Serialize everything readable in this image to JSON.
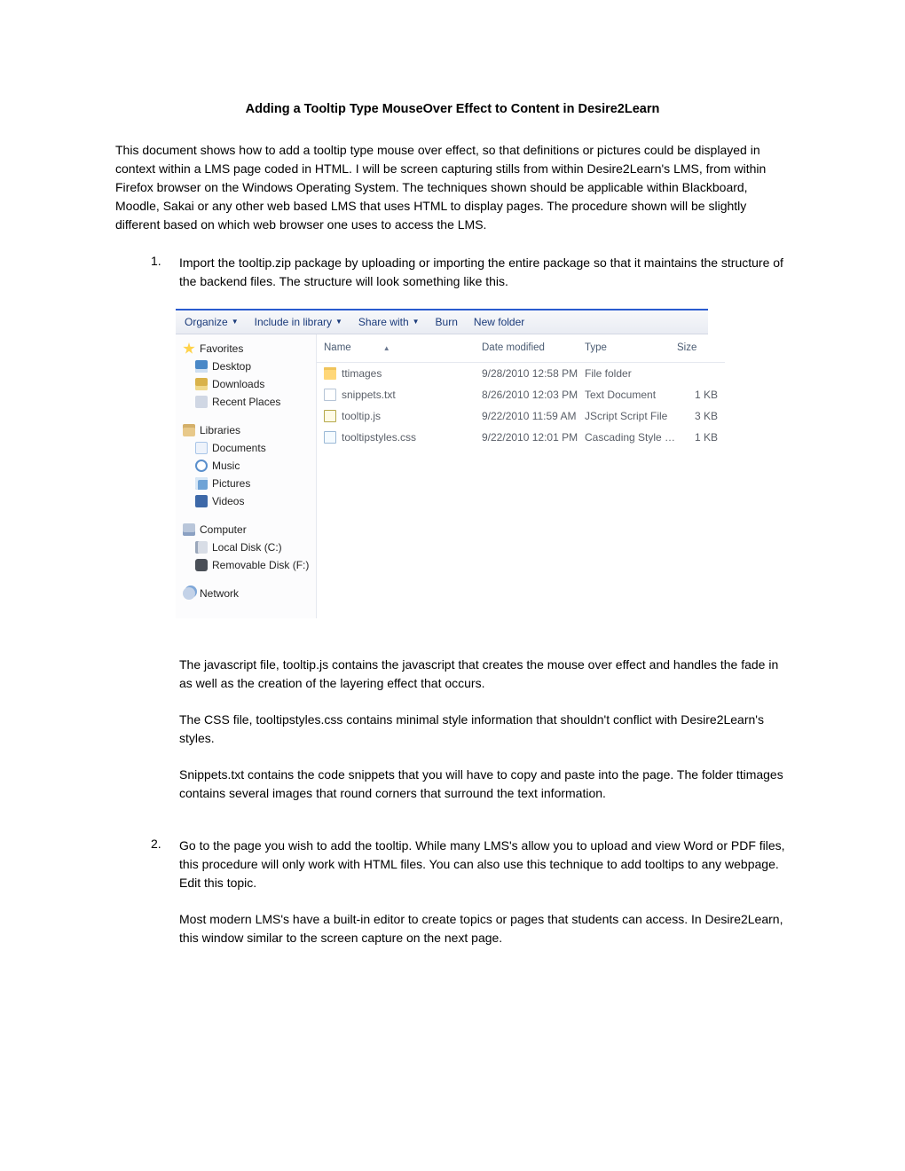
{
  "title": "Adding a Tooltip Type MouseOver Effect to Content in Desire2Learn",
  "intro": "This document shows how to add a tooltip type mouse over effect, so that definitions or pictures could be displayed in context within a LMS page coded in HTML. I will be screen capturing stills from within Desire2Learn's LMS, from within Firefox browser on the Windows Operating System. The techniques shown should be applicable within Blackboard, Moodle, Sakai or any other web based LMS that uses HTML to display pages. The procedure shown will be slightly different based on which web browser one uses to access the LMS.",
  "steps": {
    "one": {
      "num": "1.",
      "lead": "Import the tooltip.zip package by uploading or importing the entire package so that it maintains the structure of the backend files. The structure will look something like this.",
      "after": {
        "p1": "The javascript file, tooltip.js contains the javascript that creates the mouse over effect and handles the fade in as well as the creation of the layering effect that occurs.",
        "p2": "The CSS file, tooltipstyles.css contains minimal style information that shouldn't conflict with Desire2Learn's styles.",
        "p3": "Snippets.txt contains the code snippets that you will have to copy and paste into the page. The folder ttimages contains several images that round corners that surround the text information."
      }
    },
    "two": {
      "num": "2.",
      "lead": "Go to the page you wish to add the tooltip. While many LMS's allow you to upload and view Word or PDF files, this procedure will only work with HTML files.  You can also use this technique to add tooltips to any webpage. Edit this topic.",
      "after": {
        "p1": "Most modern LMS's have a built-in editor to create topics or pages that students can access. In Desire2Learn, this window similar to the screen capture on the next page."
      }
    }
  },
  "explorer": {
    "toolbar": {
      "organize": "Organize",
      "include": "Include in library",
      "share": "Share with",
      "burn": "Burn",
      "newfolder": "New folder"
    },
    "columns": {
      "name": "Name",
      "date": "Date modified",
      "type": "Type",
      "size": "Size"
    },
    "nav": {
      "favorites": "Favorites",
      "desktop": "Desktop",
      "downloads": "Downloads",
      "recent": "Recent Places",
      "libraries": "Libraries",
      "documents": "Documents",
      "music": "Music",
      "pictures": "Pictures",
      "videos": "Videos",
      "computer": "Computer",
      "localdisk": "Local Disk (C:)",
      "removable": "Removable Disk (F:)",
      "network": "Network"
    },
    "rows": {
      "r0": {
        "name": "ttimages",
        "date": "9/28/2010 12:58 PM",
        "type": "File folder",
        "size": ""
      },
      "r1": {
        "name": "snippets.txt",
        "date": "8/26/2010 12:03 PM",
        "type": "Text Document",
        "size": "1 KB"
      },
      "r2": {
        "name": "tooltip.js",
        "date": "9/22/2010 11:59 AM",
        "type": "JScript Script File",
        "size": "3 KB"
      },
      "r3": {
        "name": "tooltipstyles.css",
        "date": "9/22/2010 12:01 PM",
        "type": "Cascading Style S...",
        "size": "1 KB"
      }
    }
  }
}
